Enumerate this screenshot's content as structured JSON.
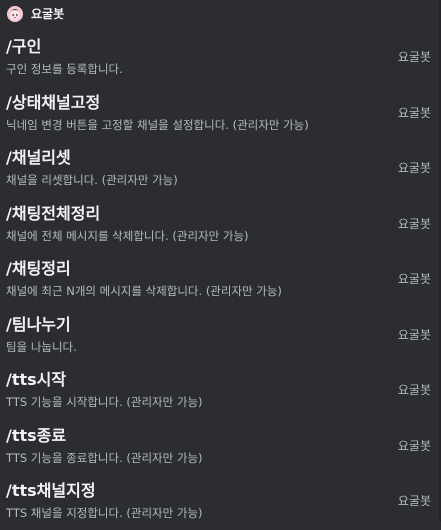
{
  "bot": {
    "name": "요굴봇",
    "avatar_icon": "bot-avatar-icon"
  },
  "commands": [
    {
      "name": "/구인",
      "description": "구인 정보를 등록합니다.",
      "source": "요굴봇"
    },
    {
      "name": "/상태채널고정",
      "description": "닉네임 변경 버튼을 고정할 채널을 설정합니다. (관리자만 가능)",
      "source": "요굴봇"
    },
    {
      "name": "/채널리셋",
      "description": "채널을 리셋합니다. (관리자만 가능)",
      "source": "요굴봇"
    },
    {
      "name": "/채팅전체정리",
      "description": "채널에 전체 메시지를 삭제합니다. (관리자만 가능)",
      "source": "요굴봇"
    },
    {
      "name": "/채팅정리",
      "description": "채널에 최근 N개의 메시지를 삭제합니다. (관리자만 가능)",
      "source": "요굴봇"
    },
    {
      "name": "/팀나누기",
      "description": "팀을 나눕니다.",
      "source": "요굴봇"
    },
    {
      "name": "/tts시작",
      "description": "TTS 기능을 시작합니다. (관리자만 가능)",
      "source": "요굴봇"
    },
    {
      "name": "/tts종료",
      "description": "TTS 기능을 종료합니다. (관리자만 가능)",
      "source": "요굴봇"
    },
    {
      "name": "/tts채널지정",
      "description": "TTS 채널을 지정합니다. (관리자만 가능)",
      "source": "요굴봇"
    }
  ],
  "colors": {
    "background": "#2b2d31",
    "title": "#f2f3f5",
    "muted": "#b5bac1",
    "avatar": "#f7c6d5"
  }
}
